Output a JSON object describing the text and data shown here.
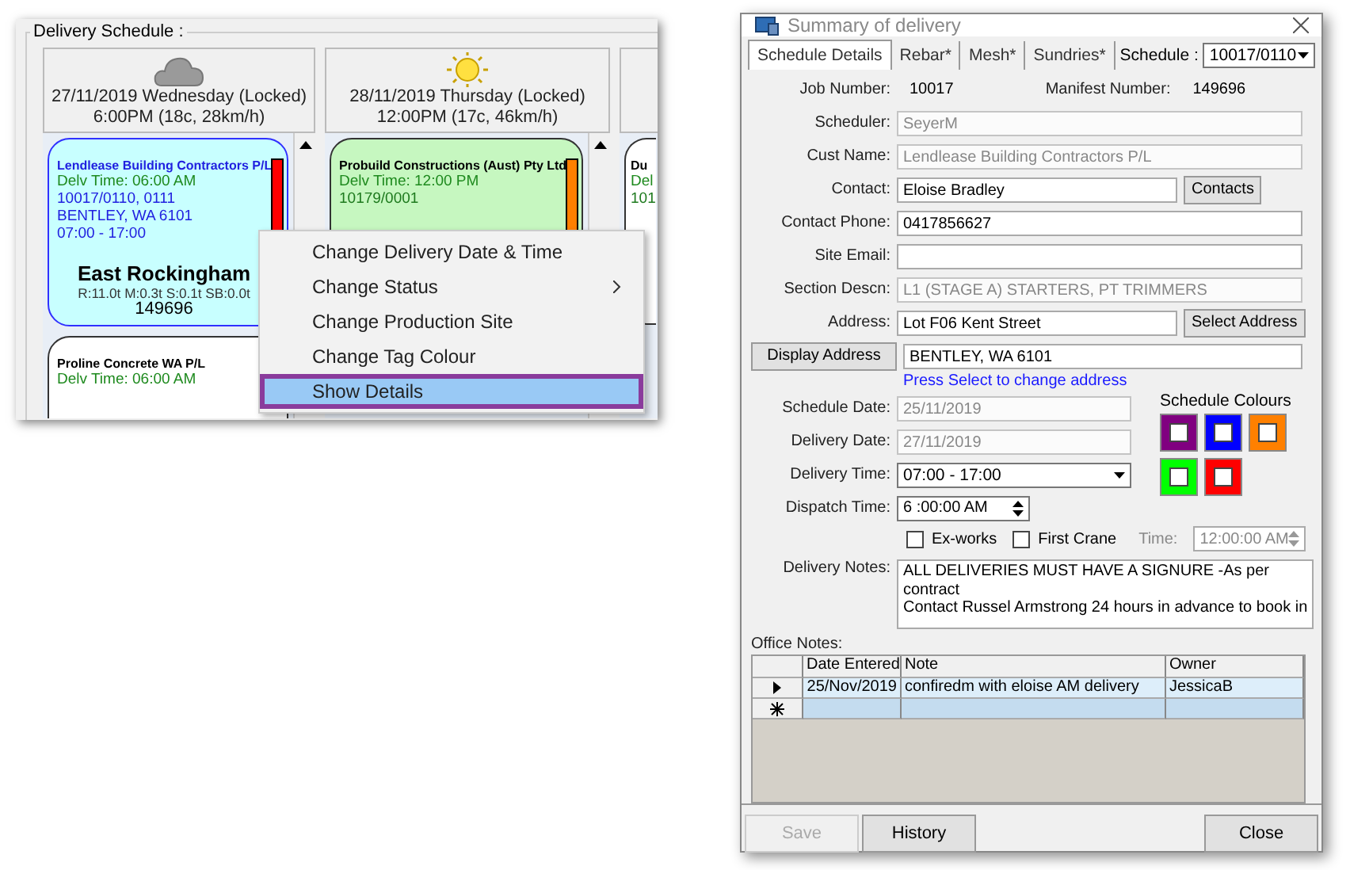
{
  "schedule": {
    "title": "Delivery Schedule :",
    "days": [
      {
        "kind": "cloud",
        "date_line": "27/11/2019 Wednesday (Locked)",
        "time_line": "6:00PM (18c, 28km/h)",
        "cards": [
          {
            "selected": true,
            "color": "#c8ffff",
            "tag": {
              "color": "#ff0000"
            },
            "company": "Lendlease Building Contractors P/L",
            "delv_time": "Delv Time: 06:00 AM",
            "job": "10017/0110, 0111",
            "address": "BENTLEY, WA 6101",
            "window": "07:00 - 17:00",
            "site": "East Rockingham",
            "weights": "R:11.0t M:0.3t S:0.1t SB:0.0t",
            "manifest": "149696"
          },
          {
            "selected": false,
            "color": "#ffffff",
            "company": "Proline Concrete WA P/L",
            "delv_time": "Delv Time: 06:00 AM"
          }
        ]
      },
      {
        "kind": "sun",
        "date_line": "28/11/2019 Thursday (Locked)",
        "time_line": "12:00PM (17c, 46km/h)",
        "cards": [
          {
            "selected": false,
            "color": "#c6f7c0",
            "tag": {
              "color": "#ff8000"
            },
            "company": "Probuild Constructions (Aust) Pty Ltd",
            "delv_time": "Delv Time: 12:00 PM",
            "job": "10179/0001"
          }
        ]
      },
      {
        "cards": [
          {
            "selected": false,
            "color": "#ffffff",
            "company": "Du",
            "delv_time": "Del",
            "job": "101"
          }
        ]
      }
    ]
  },
  "context_menu": {
    "items": [
      {
        "label": "Change Delivery Date & Time",
        "submenu": false,
        "selected": false
      },
      {
        "label": "Change Status",
        "submenu": true,
        "selected": false
      },
      {
        "label": "Change Production Site",
        "submenu": false,
        "selected": false
      },
      {
        "label": "Change Tag Colour",
        "submenu": false,
        "selected": false
      },
      {
        "label": "Show Details",
        "submenu": false,
        "selected": true
      }
    ]
  },
  "dialog": {
    "title": "Summary of delivery",
    "tabs": [
      {
        "label": "Schedule Details",
        "selected": true
      },
      {
        "label": "Rebar*",
        "selected": false
      },
      {
        "label": "Mesh*",
        "selected": false
      },
      {
        "label": "Sundries*",
        "selected": false
      }
    ],
    "schedule": {
      "label": "Schedule :",
      "value": "10017/0110"
    },
    "job_number": {
      "label": "Job Number:",
      "value": "10017"
    },
    "manifest_number": {
      "label": "Manifest Number:",
      "value": "149696"
    },
    "fields": [
      {
        "label": "Scheduler:",
        "value": "SeyerM",
        "disabled": true
      },
      {
        "label": "Cust Name:",
        "value": "Lendlease Building Contractors P/L",
        "disabled": true
      },
      {
        "label": "Contact:",
        "value": "Eloise Bradley",
        "disabled": false,
        "button": "Contacts"
      },
      {
        "label": "Contact Phone:",
        "value": "0417856627",
        "disabled": false
      },
      {
        "label": "Site Email:",
        "disabled": false
      },
      {
        "label": "Section Descn:",
        "value": "L1 (STAGE A) STARTERS, PT TRIMMERS",
        "disabled": true
      },
      {
        "label": "Address:",
        "value": "Lot F06 Kent Street",
        "disabled": false,
        "button": "Select Address"
      }
    ],
    "display_address": {
      "button": "Display Address",
      "value": "BENTLEY, WA 6101",
      "hint": "Press Select to change address"
    },
    "schedule_date": {
      "label": "Schedule Date:",
      "value": "25/11/2019",
      "disabled": true
    },
    "delivery_date": {
      "label": "Delivery Date:",
      "value": "27/11/2019",
      "disabled": true
    },
    "delivery_time": {
      "label": "Delivery Time:",
      "value": "07:00 - 17:00"
    },
    "dispatch_time": {
      "label": "Dispatch Time:",
      "value": "6 :00:00 AM"
    },
    "schedule_colours": {
      "title": "Schedule Colours",
      "swatches": [
        {
          "color": "#800080"
        },
        {
          "color": "#0000ff"
        },
        {
          "color": "#ff8000"
        },
        {
          "color": "#00ff00"
        },
        {
          "color": "#ff0000"
        }
      ]
    },
    "checks": [
      {
        "label": "Ex-works",
        "checked": false
      },
      {
        "label": "First Crane",
        "checked": false
      }
    ],
    "crane_time": {
      "label": "Time:",
      "value": "12:00:00 AM",
      "disabled": true
    },
    "delivery_notes": {
      "label": "Delivery Notes:",
      "lines": [
        "ALL DELIVERIES MUST HAVE A SIGNURE -As per",
        "contract",
        "Contact Russel Armstrong 24 hours in advance to book in"
      ]
    },
    "office_notes": {
      "label": "Office Notes:",
      "columns": [
        "Date Entered",
        "Note",
        "Owner"
      ],
      "rows": [
        {
          "kind": "current",
          "cells": [
            "25/Nov/2019",
            "confiredm with eloise AM delivery",
            "JessicaB"
          ]
        },
        {
          "kind": "new",
          "cells": []
        }
      ]
    },
    "buttons": [
      {
        "label": "Save",
        "disabled": true,
        "kind": "left"
      },
      {
        "label": "History",
        "disabled": false,
        "kind": "left"
      },
      {
        "label": "Close",
        "disabled": false,
        "kind": "right"
      }
    ]
  }
}
